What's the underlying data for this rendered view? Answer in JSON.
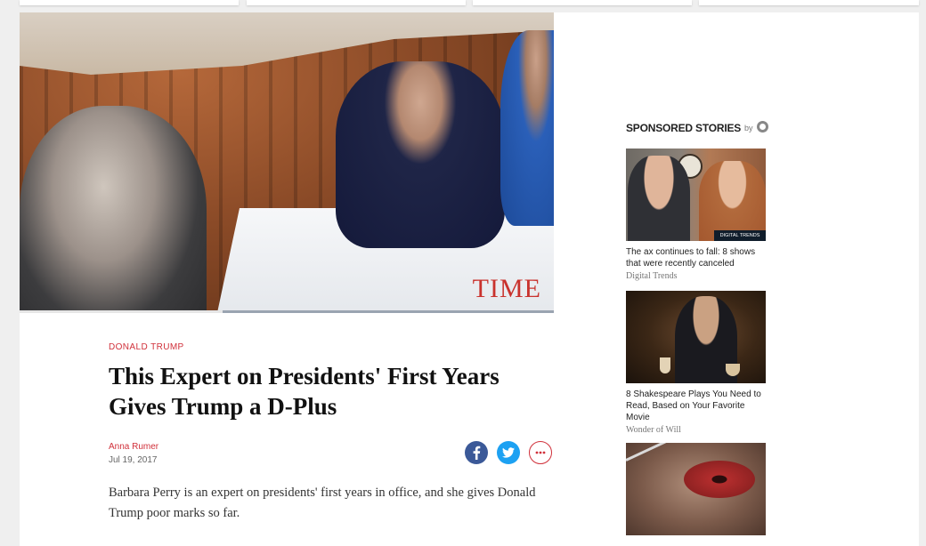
{
  "article": {
    "hero_watermark": "TIME",
    "video_progress_fraction": 0.38,
    "kicker": "DONALD TRUMP",
    "headline": "This Expert on Presidents' First Years Gives Trump a D-Plus",
    "author": "Anna Rumer",
    "date": "Jul 19, 2017",
    "dek": "Barbara Perry is an expert on presidents' first years in office, and she gives Donald Trump poor marks so far.",
    "share": {
      "facebook_icon": "facebook-icon",
      "twitter_icon": "twitter-icon",
      "more_icon": "more-icon"
    }
  },
  "sponsored": {
    "title": "SPONSORED STORIES",
    "by_label": "by",
    "stories": [
      {
        "headline": "The ax continues to fall: 8 shows that were recently canceled",
        "source": "Digital Trends",
        "image_tag": "DIGITAL TRENDS"
      },
      {
        "headline": "8 Shakespeare Plays You Need to Read, Based on Your Favorite Movie",
        "source": "Wonder of Will"
      }
    ]
  },
  "colors": {
    "accent_red": "#d0303a",
    "facebook_blue": "#3b5998",
    "twitter_blue": "#1da1f2"
  }
}
